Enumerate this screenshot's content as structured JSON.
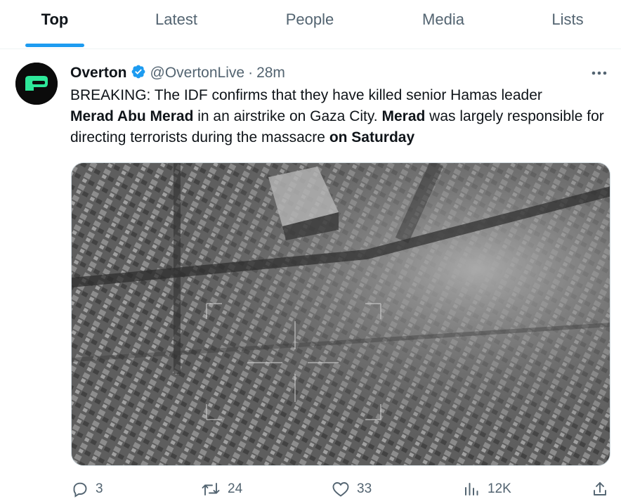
{
  "tabs": [
    {
      "label": "Top",
      "active": true
    },
    {
      "label": "Latest",
      "active": false
    },
    {
      "label": "People",
      "active": false
    },
    {
      "label": "Media",
      "active": false
    },
    {
      "label": "Lists",
      "active": false
    }
  ],
  "tweet": {
    "display_name": "Overton",
    "handle": "@OvertonLive",
    "separator": "·",
    "time": "28m",
    "verified_icon": "verified-badge-icon",
    "text": {
      "part1": "BREAKING: The IDF confirms that they have killed senior Hamas leader",
      "bold1": "Merad Abu Merad",
      "part2": " in an airstrike on Gaza City. ",
      "bold2": "Merad",
      "part3": " was largely responsible for directing terrorists during the massacre ",
      "bold3": "on Saturday"
    },
    "media_icon": "aerial-drone-footage-image",
    "actions": {
      "replies": "3",
      "retweets": "24",
      "likes": "33",
      "views": "12K"
    }
  },
  "colors": {
    "accent": "#1d9bf0",
    "secondary_text": "#536471",
    "primary_text": "#0f1419"
  }
}
